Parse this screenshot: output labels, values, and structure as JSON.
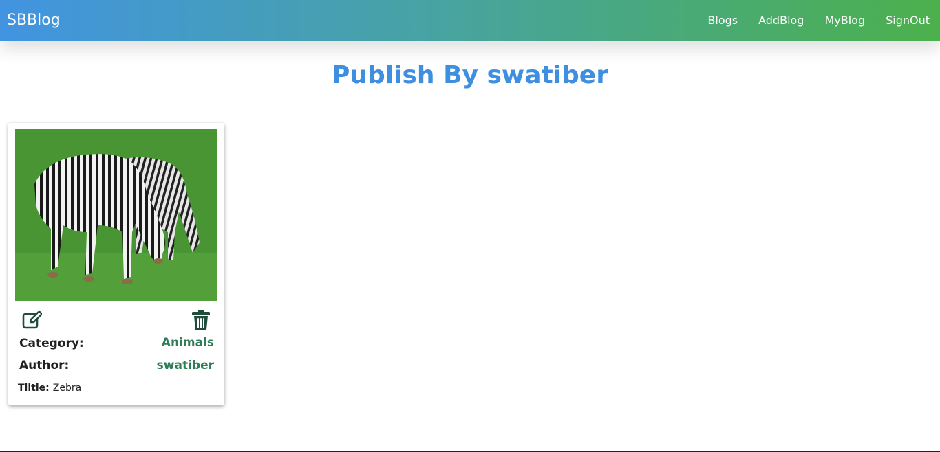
{
  "navbar": {
    "brand": "SBBlog",
    "links": [
      {
        "label": "Blogs"
      },
      {
        "label": "AddBlog"
      },
      {
        "label": "MyBlog"
      },
      {
        "label": "SignOut"
      }
    ]
  },
  "page": {
    "title": "Publish By swatiber"
  },
  "card": {
    "image_subject": "zebras grazing on grass",
    "icons": {
      "edit": "edit-icon",
      "delete": "trash-icon"
    },
    "category_label": "Category:",
    "category_value": "Animals",
    "author_label": "Author:",
    "author_value": "swatiber",
    "title_label": "Tiltle:",
    "title_value": "Zebra"
  },
  "colors": {
    "nav_gradient_start": "#4294e1",
    "nav_gradient_end": "#4cb04c",
    "title": "#3e8fdf",
    "value_green": "#2e7d57",
    "icon_dark_green": "#1f4d3c"
  }
}
